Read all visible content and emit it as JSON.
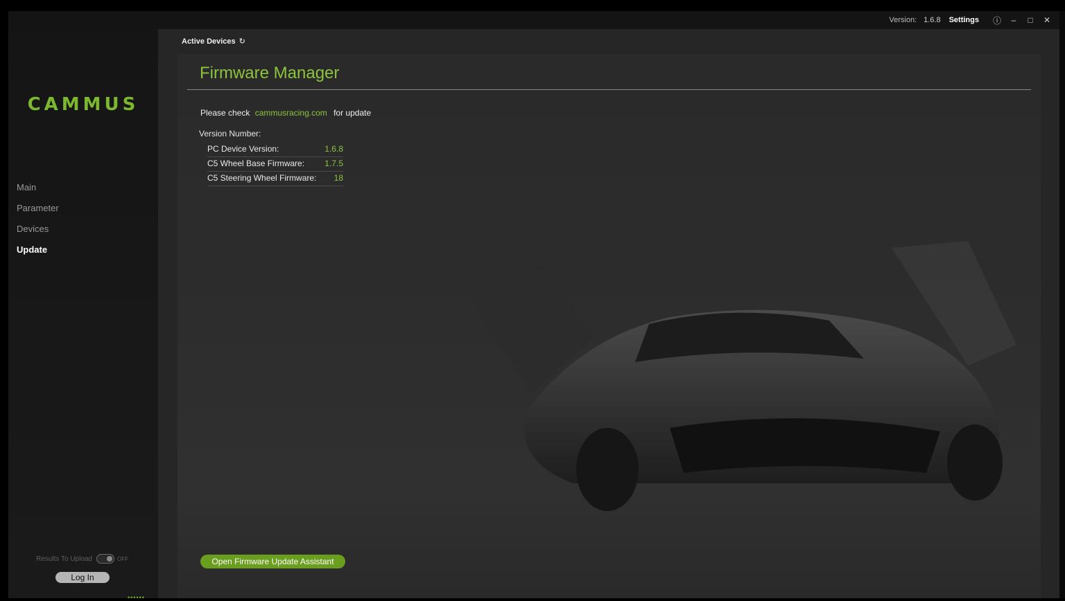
{
  "titlebar": {
    "version_label": "Version:",
    "version_value": "1.6.8",
    "settings_label": "Settings",
    "help_icon": "help-icon",
    "minimize_icon": "minimize-icon",
    "maximize_icon": "maximize-icon",
    "close_icon": "close-icon"
  },
  "sidebar": {
    "logo": "CAMMUS",
    "nav": [
      {
        "label": "Main"
      },
      {
        "label": "Parameter"
      },
      {
        "label": "Devices"
      },
      {
        "label": "Update",
        "active": true
      }
    ],
    "results_upload_label": "Results To Upload",
    "toggle_state": "OFF",
    "login_label": "Log In",
    "dots": "••••••"
  },
  "header": {
    "active_devices": "Active Devices",
    "refresh_icon": "refresh-icon"
  },
  "panel": {
    "title": "Firmware Manager",
    "check_prefix": "Please check",
    "check_link": "cammusracing.com",
    "check_suffix": "for update",
    "version_number_label": "Version Number:",
    "versions": [
      {
        "label": "PC Device Version:",
        "value": "1.6.8"
      },
      {
        "label": "C5 Wheel Base Firmware:",
        "value": "1.7.5"
      },
      {
        "label": "C5 Steering Wheel Firmware:",
        "value": "18"
      }
    ],
    "update_button": "Open Firmware Update Assistant"
  },
  "colors": {
    "accent": "#8dc43c",
    "button": "#6a9e1f"
  }
}
